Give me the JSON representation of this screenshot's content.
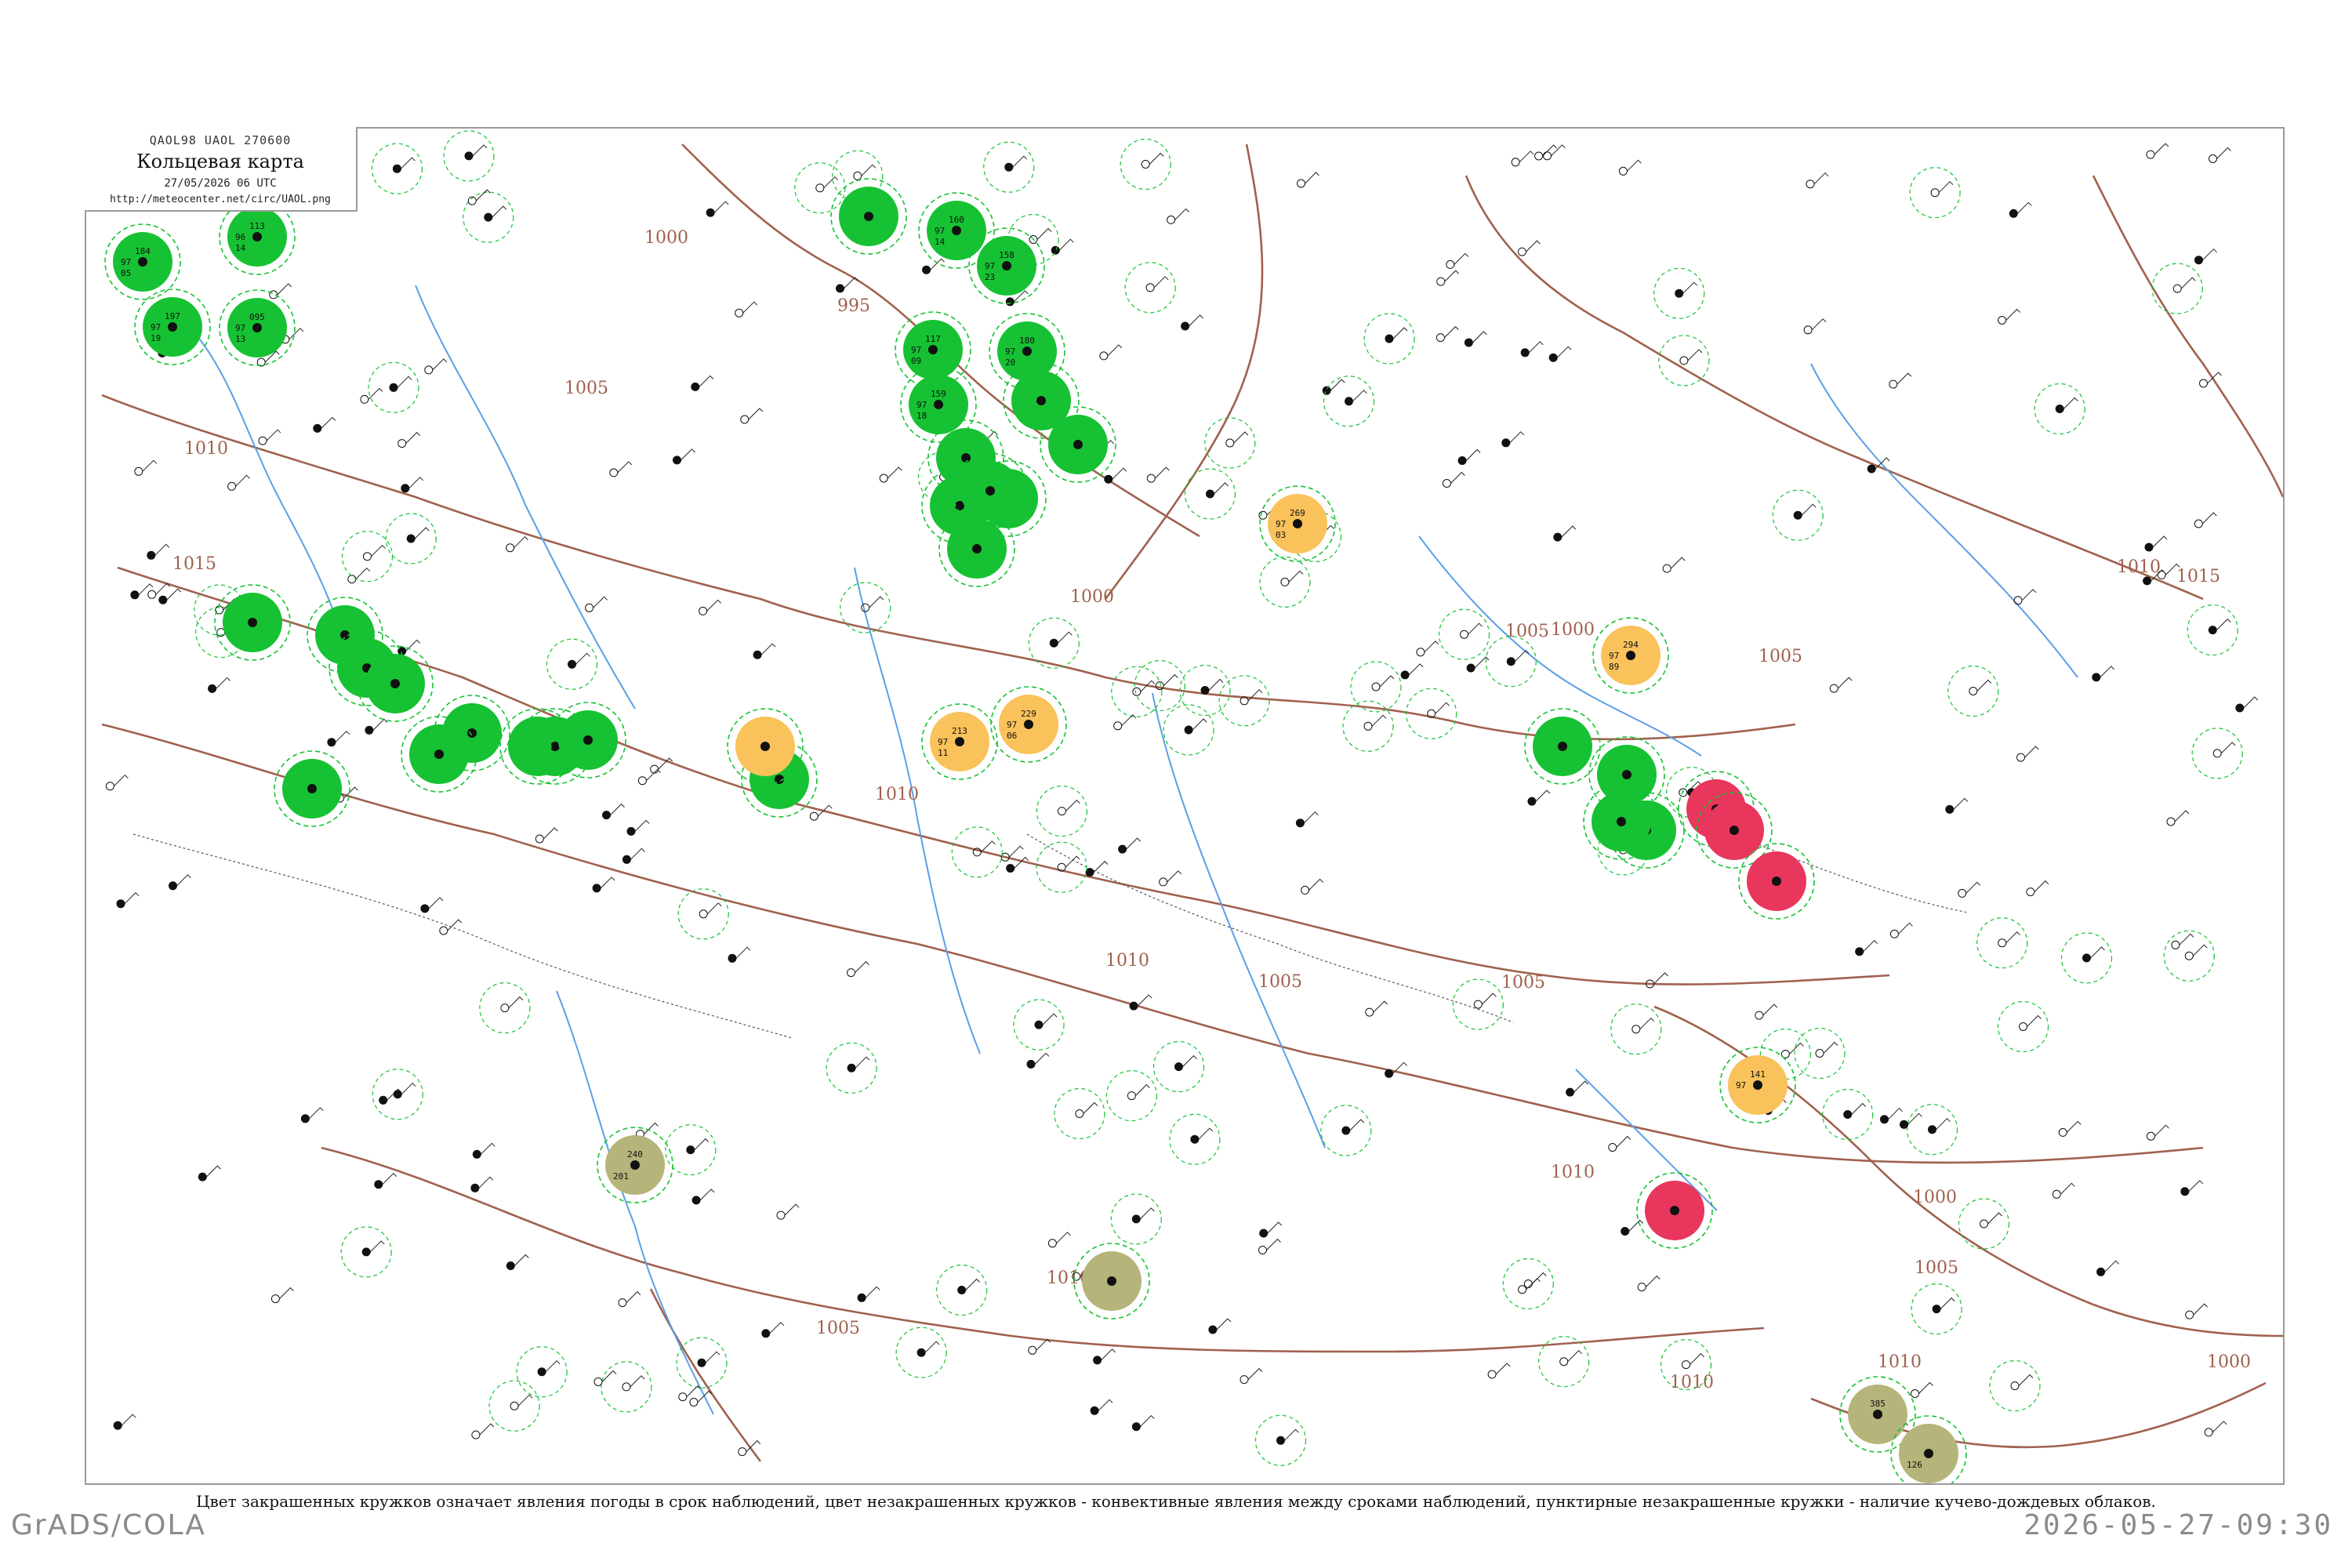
{
  "title_box": {
    "code": "QAOL98  UAOL  270600",
    "title": "Кольцевая карта",
    "datetime": "27/05/2026 06 UTC",
    "url": "http://meteocenter.net/circ/UAOL.png"
  },
  "caption": "Цвет закрашенных кружков означает явления погоды в срок наблюдений, цвет незакрашенных кружков - конвективные явления между сроками наблюдений, пунктирные незакрашенные кружки - наличие кучево-дождевых облаков.",
  "footer": {
    "left": "GrADS/COLA",
    "right": "2026-05-27-09:30"
  },
  "colors": {
    "green": "#16c233",
    "orange": "#f9c25a",
    "red": "#e8365d",
    "olive": "#b5b47a",
    "isobar": "#a0614e",
    "river": "#5aa0e6"
  },
  "isobar_labels": [
    "1000",
    "1005",
    "1010",
    "1015",
    "995",
    "1000",
    "1005",
    "1010",
    "1015",
    "1000",
    "1005",
    "1010",
    "1005",
    "1010",
    "1005",
    "1000",
    "1010",
    "1005",
    "1010",
    "1005",
    "1010",
    "1000",
    "1010"
  ],
  "stations": [
    {
      "fill": "green",
      "p": "184",
      "t": "97",
      "d": "05"
    },
    {
      "fill": "green",
      "p": "113",
      "t": "96",
      "d": "14"
    },
    {
      "fill": "green",
      "p": "197",
      "t": "97",
      "d": "19"
    },
    {
      "fill": "green",
      "p": "095",
      "t": "97",
      "d": "13"
    },
    {
      "fill": "green",
      "p": "",
      "t": "",
      "d": ""
    },
    {
      "fill": "green",
      "p": "160",
      "t": "97",
      "d": "14"
    },
    {
      "fill": "green",
      "p": "158",
      "t": "97",
      "d": "23"
    },
    {
      "fill": "green",
      "p": "117",
      "t": "97",
      "d": "09"
    },
    {
      "fill": "green",
      "p": "180",
      "t": "97",
      "d": "20"
    },
    {
      "fill": "green",
      "p": "159",
      "t": "97",
      "d": "18"
    },
    {
      "fill": "green",
      "p": "",
      "t": "",
      "d": ""
    },
    {
      "fill": "green",
      "p": "",
      "t": "",
      "d": ""
    },
    {
      "fill": "green",
      "p": "",
      "t": "",
      "d": ""
    },
    {
      "fill": "green",
      "p": "",
      "t": "",
      "d": ""
    },
    {
      "fill": "green",
      "p": "",
      "t": "",
      "d": ""
    },
    {
      "fill": "green",
      "p": "",
      "t": "",
      "d": ""
    },
    {
      "fill": "green",
      "p": "",
      "t": "",
      "d": ""
    },
    {
      "fill": "green",
      "p": "",
      "t": "",
      "d": ""
    },
    {
      "fill": "green",
      "p": "",
      "t": "",
      "d": ""
    },
    {
      "fill": "green",
      "p": "",
      "t": "",
      "d": ""
    },
    {
      "fill": "green",
      "p": "",
      "t": "",
      "d": ""
    },
    {
      "fill": "green",
      "p": "",
      "t": "",
      "d": ""
    },
    {
      "fill": "green",
      "p": "",
      "t": "",
      "d": ""
    },
    {
      "fill": "green",
      "p": "",
      "t": "",
      "d": ""
    },
    {
      "fill": "green",
      "p": "",
      "t": "",
      "d": ""
    },
    {
      "fill": "green",
      "p": "",
      "t": "",
      "d": ""
    },
    {
      "fill": "green",
      "p": "",
      "t": "",
      "d": ""
    },
    {
      "fill": "green",
      "p": "",
      "t": "",
      "d": ""
    },
    {
      "fill": "green",
      "p": "",
      "t": "",
      "d": ""
    },
    {
      "fill": "green",
      "p": "",
      "t": "",
      "d": ""
    },
    {
      "fill": "green",
      "p": "",
      "t": "",
      "d": ""
    },
    {
      "fill": "green",
      "p": "",
      "t": "",
      "d": ""
    },
    {
      "fill": "orange",
      "p": "",
      "t": "",
      "d": ""
    },
    {
      "fill": "orange",
      "p": "213",
      "t": "97",
      "d": "11"
    },
    {
      "fill": "orange",
      "p": "229",
      "t": "97",
      "d": "06"
    },
    {
      "fill": "orange",
      "p": "269",
      "t": "97",
      "d": "03"
    },
    {
      "fill": "orange",
      "p": "294",
      "t": "97",
      "d": "89"
    },
    {
      "fill": "orange",
      "p": "141",
      "t": "97",
      "d": ""
    },
    {
      "fill": "red",
      "p": "",
      "t": "",
      "d": ""
    },
    {
      "fill": "red",
      "p": "",
      "t": "",
      "d": ""
    },
    {
      "fill": "red",
      "p": "",
      "t": "",
      "d": ""
    },
    {
      "fill": "red",
      "p": "",
      "t": "",
      "d": ""
    },
    {
      "fill": "olive",
      "p": "240",
      "t": "",
      "d": "201"
    },
    {
      "fill": "olive",
      "p": "",
      "t": "",
      "d": ""
    },
    {
      "fill": "olive",
      "p": "385",
      "t": "",
      "d": ""
    },
    {
      "fill": "olive",
      "p": "",
      "t": "",
      "d": "126"
    }
  ]
}
